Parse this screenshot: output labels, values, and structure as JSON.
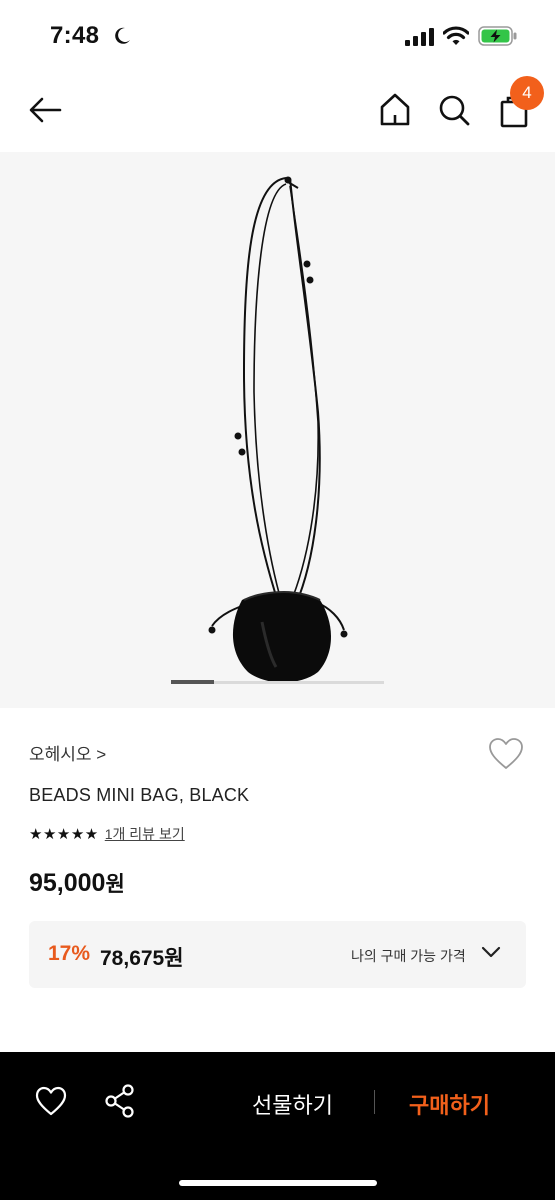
{
  "status_bar": {
    "time": "7:48"
  },
  "nav": {
    "cart_count": "4"
  },
  "carousel": {
    "current_slide": 1,
    "total_slides": 5
  },
  "product": {
    "brand": "오헤시오 >",
    "name": "BEADS MINI BAG, BLACK",
    "stars": "★★★★★",
    "rating": 5,
    "review_link": "1개 리뷰 보기",
    "price_number": "95,000",
    "price_unit": "원"
  },
  "discount": {
    "rate": "17%",
    "price": "78,675원",
    "label": "나의 구매 가능 가격"
  },
  "bottom_bar": {
    "gift_label": "선물하기",
    "buy_label": "구매하기"
  },
  "colors": {
    "accent": "#f2601b",
    "discount": "#e85a1d",
    "bottom_bar": "#000000"
  }
}
